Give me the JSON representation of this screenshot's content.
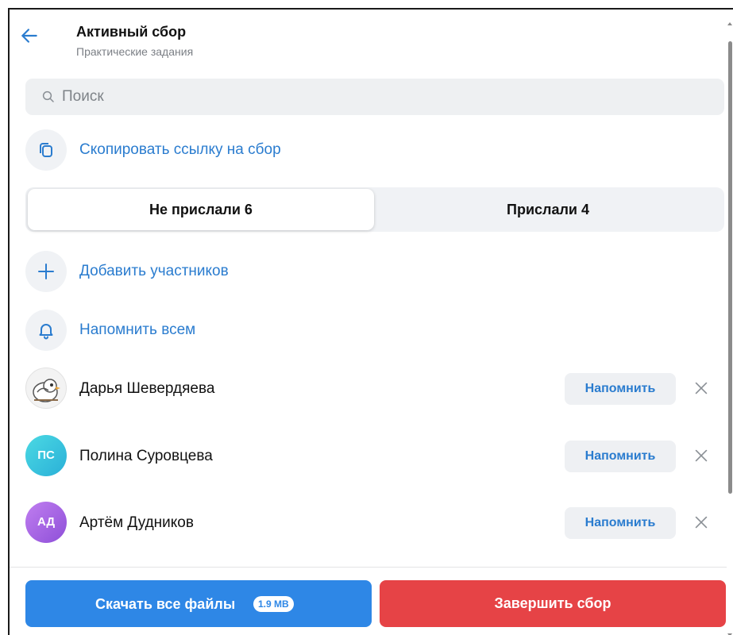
{
  "header": {
    "title": "Активный сбор",
    "subtitle": "Практические задания",
    "back_icon": "arrow-left-icon"
  },
  "search": {
    "placeholder": "Поиск",
    "value": ""
  },
  "actions": {
    "copy_link": "Скопировать ссылку на сбор",
    "add_participants": "Добавить участников",
    "remind_all": "Напомнить всем"
  },
  "tabs": [
    {
      "label": "Не прислали 6",
      "active": true
    },
    {
      "label": "Прислали 4",
      "active": false
    }
  ],
  "participants": [
    {
      "name": "Дарья Шевердяева",
      "initials": "",
      "remind_label": "Напомнить"
    },
    {
      "name": "Полина Суровцева",
      "initials": "ПС",
      "remind_label": "Напомнить"
    },
    {
      "name": "Артём Дудников",
      "initials": "АД",
      "remind_label": "Напомнить"
    }
  ],
  "footer": {
    "download_label": "Скачать все файлы",
    "download_size": "1.9 MB",
    "finish_label": "Завершить сбор"
  },
  "colors": {
    "accent": "#2a7ccf",
    "primary_button": "#2e87e6",
    "danger_button": "#e64346",
    "surface": "#f0f2f5"
  }
}
